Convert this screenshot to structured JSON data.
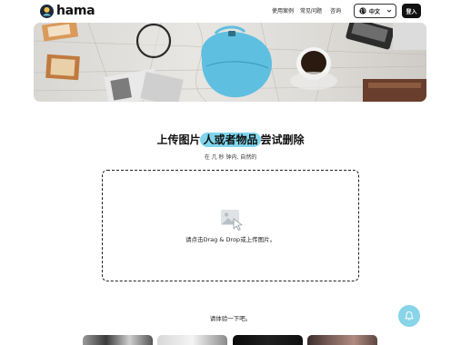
{
  "header": {
    "logo_text": "hama",
    "nav": [
      "使用案例",
      "常见问题",
      "咨询"
    ],
    "language": "中文",
    "login": "登入"
  },
  "hero": {
    "image": "desk-flatlay-with-highlighted-bag"
  },
  "main": {
    "headline_before": "上传图片",
    "headline_highlight": "人或者物品",
    "headline_after": "尝试删除",
    "subline": "在 几 秒 钟内, 自然的",
    "dropzone_text": "请点击Drag & Drop或上传图片。",
    "try_text": "请体验一下吧。"
  },
  "colors": {
    "accent": "#7fd6ec",
    "button_dark": "#111111",
    "fab": "#88d4e8"
  },
  "icons": [
    "logo-icon",
    "globe-icon",
    "chevron-down-icon",
    "image-upload-icon",
    "bell-icon"
  ]
}
